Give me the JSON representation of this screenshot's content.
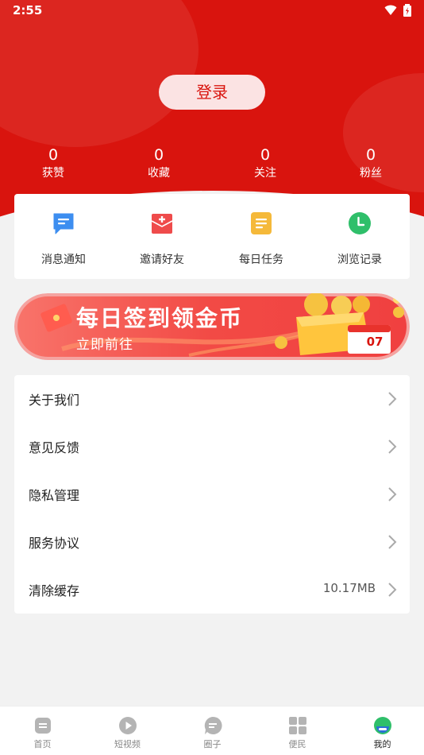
{
  "status_bar": {
    "time": "2:55"
  },
  "header": {
    "login_label": "登录"
  },
  "stats": [
    {
      "num": "0",
      "label": "获赞"
    },
    {
      "num": "0",
      "label": "收藏"
    },
    {
      "num": "0",
      "label": "关注"
    },
    {
      "num": "0",
      "label": "粉丝"
    }
  ],
  "quick_actions": [
    {
      "label": "消息通知",
      "icon": "message-icon",
      "color": "#3d8ef0"
    },
    {
      "label": "邀请好友",
      "icon": "invite-envelope-icon",
      "color": "#ef4b4b"
    },
    {
      "label": "每日任务",
      "icon": "task-note-icon",
      "color": "#f5b93a"
    },
    {
      "label": "浏览记录",
      "icon": "clock-history-icon",
      "color": "#2fbf6a"
    }
  ],
  "banner": {
    "title": "每日签到领金币",
    "subtitle": "立即前往",
    "calendar_day": "07"
  },
  "menu": [
    {
      "label": "关于我们",
      "value": ""
    },
    {
      "label": "意见反馈",
      "value": ""
    },
    {
      "label": "隐私管理",
      "value": ""
    },
    {
      "label": "服务协议",
      "value": ""
    },
    {
      "label": "清除缓存",
      "value": "10.17MB"
    }
  ],
  "tabs": [
    {
      "label": "首页",
      "icon": "home-icon",
      "active": false
    },
    {
      "label": "短视频",
      "icon": "play-icon",
      "active": false
    },
    {
      "label": "圈子",
      "icon": "chat-bubble-icon",
      "active": false
    },
    {
      "label": "便民",
      "icon": "grid-icon",
      "active": false
    },
    {
      "label": "我的",
      "icon": "profile-icon",
      "active": true
    }
  ],
  "colors": {
    "brand": "#d9140e",
    "background": "#f2f2f2"
  }
}
